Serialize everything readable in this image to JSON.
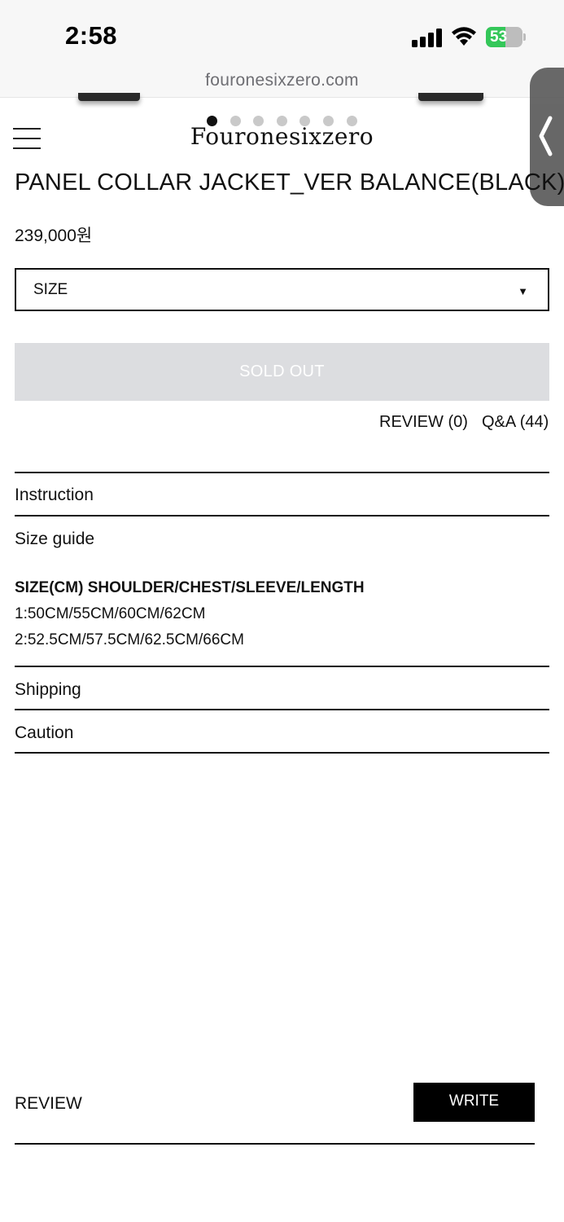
{
  "status_bar": {
    "time": "2:58",
    "battery_percent": "53",
    "battery_level": 0.53,
    "battery_color": "#34c759"
  },
  "browser": {
    "url": "fouronesixzero.com"
  },
  "header": {
    "logo": "Fouronesixzero",
    "menu_icon": "hamburger-menu-icon",
    "carousel_total": 7,
    "carousel_active": 0
  },
  "side_tab": {
    "icon": "chevron-left-icon"
  },
  "product": {
    "title": "PANEL COLLAR JACKET_VER BALANCE(BLACK)",
    "price": "239,000원",
    "size_select": {
      "selected": "SIZE",
      "caret": "▼"
    },
    "sold_out_label": "SOLD OUT",
    "review_link": "REVIEW (0)",
    "qa_link": "Q&A (44)"
  },
  "sections": {
    "instruction": "Instruction",
    "size_guide": "Size guide",
    "size_guide_header": "SIZE(CM) SHOULDER/CHEST/SLEEVE/LENGTH",
    "size_rows": [
      "1:50CM/55CM/60CM/62CM",
      "2:52.5CM/57.5CM/62.5CM/66CM"
    ],
    "shipping": "Shipping",
    "caution": "Caution"
  },
  "review_section": {
    "heading": "REVIEW",
    "write_label": "WRITE"
  },
  "colors": {
    "sold_out_bg": "#dcdde0",
    "accent_black": "#000000"
  }
}
